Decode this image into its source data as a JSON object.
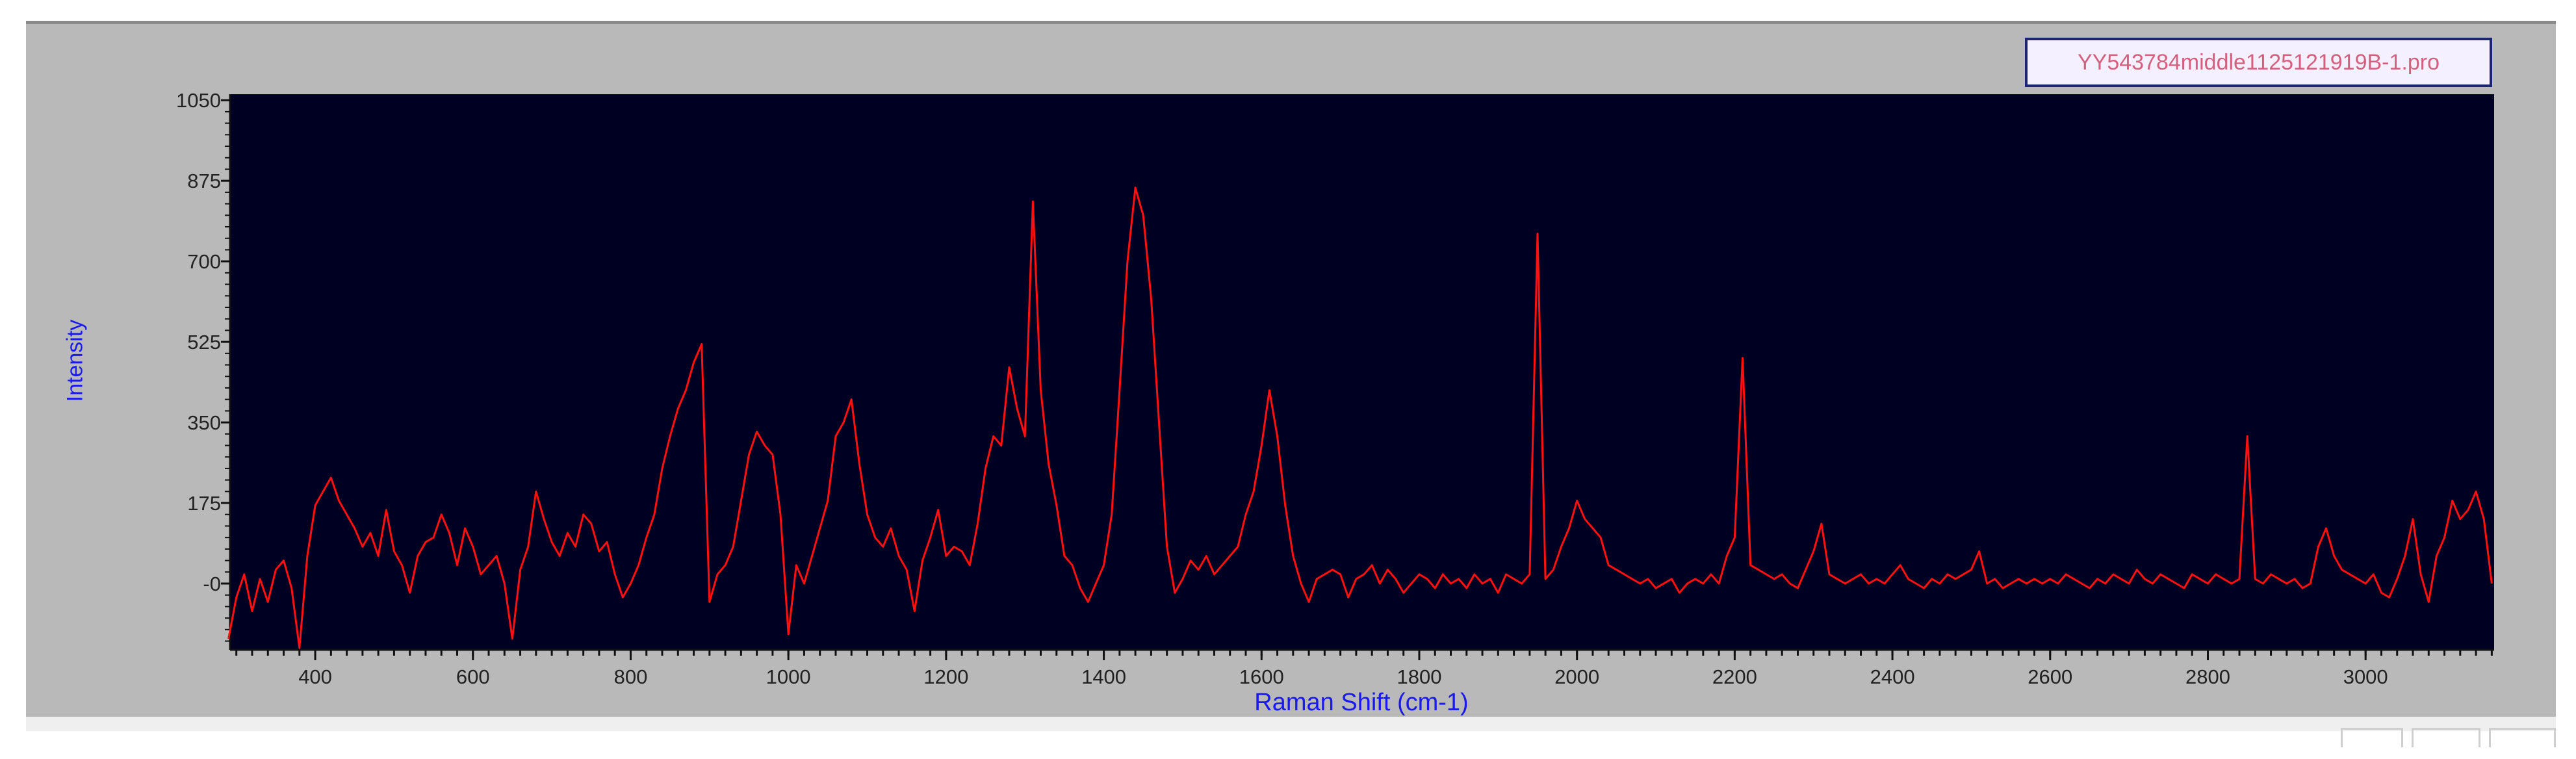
{
  "chart_data": {
    "type": "line",
    "title": "",
    "legend": "YY543784middle1125121919B-1.pro",
    "legend_position": "top-right",
    "xlabel": "Raman Shift (cm-1)",
    "ylabel": "Intensity",
    "xlim": [
      292,
      3163
    ],
    "ylim": [
      -144,
      1063
    ],
    "x_ticks": [
      400,
      600,
      800,
      1000,
      1200,
      1400,
      1600,
      1800,
      2000,
      2200,
      2400,
      2600,
      2800,
      3000
    ],
    "x_tick_labels": [
      "400",
      "600",
      "800",
      "1000",
      "1200",
      "1400",
      "1600",
      "1800",
      "2000",
      "2200",
      "2400",
      "2600",
      "2800",
      "3000"
    ],
    "y_ticks": [
      0,
      175,
      350,
      525,
      700,
      875,
      1050
    ],
    "y_tick_labels": [
      "-0",
      "175",
      "350",
      "525",
      "700",
      "875",
      "1050"
    ],
    "grid": false,
    "background_color": "#000022",
    "series": [
      {
        "name": "YY543784middle1125121919B-1.pro",
        "color": "#ff1010",
        "x_start": 290,
        "x_step": 10,
        "y": [
          -120,
          -30,
          20,
          -60,
          10,
          -40,
          30,
          50,
          -10,
          -140,
          60,
          170,
          200,
          230,
          180,
          150,
          120,
          80,
          110,
          60,
          160,
          70,
          40,
          -20,
          60,
          90,
          100,
          150,
          110,
          40,
          120,
          80,
          20,
          40,
          60,
          0,
          -120,
          30,
          80,
          200,
          140,
          90,
          60,
          110,
          80,
          150,
          130,
          70,
          90,
          20,
          -30,
          0,
          40,
          100,
          150,
          250,
          320,
          380,
          420,
          480,
          520,
          -40,
          20,
          40,
          80,
          180,
          280,
          330,
          300,
          280,
          150,
          -110,
          40,
          0,
          60,
          120,
          180,
          320,
          350,
          400,
          260,
          150,
          100,
          80,
          120,
          60,
          30,
          -60,
          50,
          100,
          160,
          60,
          80,
          70,
          40,
          130,
          250,
          320,
          300,
          470,
          380,
          320,
          830,
          420,
          260,
          170,
          60,
          40,
          -10,
          -40,
          0,
          40,
          150,
          420,
          700,
          860,
          800,
          620,
          350,
          80,
          -20,
          10,
          50,
          30,
          60,
          20,
          40,
          60,
          80,
          150,
          200,
          300,
          420,
          320,
          170,
          60,
          0,
          -40,
          10,
          20,
          30,
          20,
          -30,
          10,
          20,
          40,
          0,
          30,
          10,
          -20,
          0,
          20,
          10,
          -10,
          20,
          0,
          10,
          -10,
          20,
          0,
          10,
          -20,
          20,
          10,
          0,
          20,
          760,
          10,
          30,
          80,
          120,
          180,
          140,
          120,
          100,
          40,
          30,
          20,
          10,
          0,
          10,
          -10,
          0,
          10,
          -20,
          0,
          10,
          0,
          20,
          0,
          60,
          100,
          490,
          40,
          30,
          20,
          10,
          20,
          0,
          -10,
          30,
          70,
          130,
          20,
          10,
          0,
          10,
          20,
          0,
          10,
          0,
          20,
          40,
          10,
          0,
          -10,
          10,
          0,
          20,
          10,
          20,
          30,
          70,
          0,
          10,
          -10,
          0,
          10,
          0,
          10,
          0,
          10,
          0,
          20,
          10,
          0,
          -10,
          10,
          0,
          20,
          10,
          0,
          30,
          10,
          0,
          20,
          10,
          0,
          -10,
          20,
          10,
          0,
          20,
          10,
          0,
          10,
          320,
          10,
          0,
          20,
          10,
          0,
          10,
          -10,
          0,
          80,
          120,
          60,
          30,
          20,
          10,
          0,
          20,
          -20,
          -30,
          10,
          60,
          140,
          20,
          -40,
          60,
          100,
          180,
          140,
          160,
          200,
          140,
          0
        ]
      }
    ]
  }
}
